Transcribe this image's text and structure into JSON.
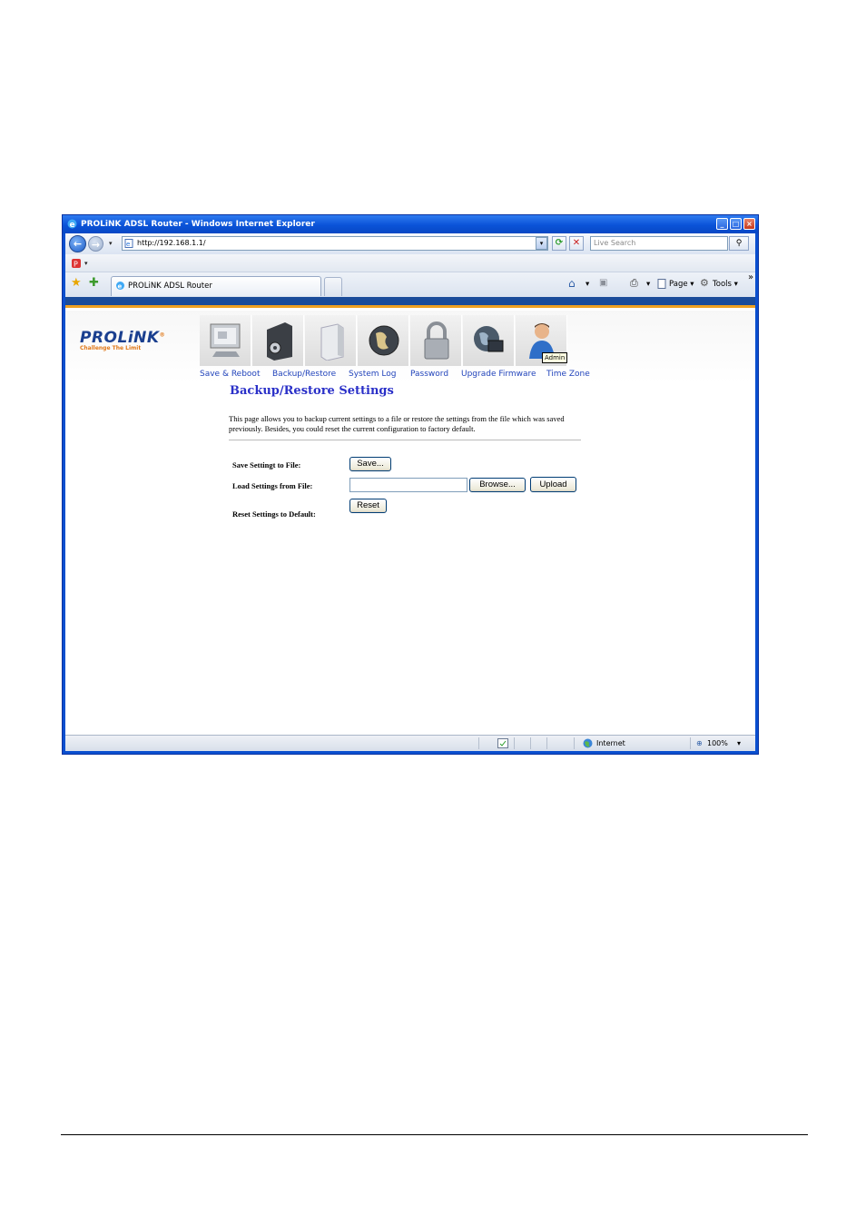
{
  "window": {
    "title": "PROLiNK ADSL Router - Windows Internet Explorer",
    "minimize": "_",
    "maximize": "□",
    "close": "×"
  },
  "navbar": {
    "back_icon": "back-arrow-icon",
    "forward_icon": "forward-arrow-icon",
    "back_glyph": "←",
    "forward_glyph": "→",
    "address": "http://192.168.1.1/",
    "refresh_glyph": "⟳",
    "stop_glyph": "✕",
    "search_placeholder": "Live Search",
    "search_glyph": "⚲",
    "caret": "▾"
  },
  "tab": {
    "title": "PROLiNK ADSL Router"
  },
  "command_bar": {
    "page_label": "Page",
    "tools_label": "Tools",
    "more": "»",
    "favorites_glyph": "★",
    "add_fav_glyph": "✚",
    "home_glyph": "⌂",
    "feeds_glyph": "▣",
    "print_glyph": "⎙",
    "tools_glyph": "⚙"
  },
  "router": {
    "brand": "PROLiNK",
    "brand_mark": "®",
    "tagline": "Challenge The Limit",
    "nav": [
      {
        "label": "Save & Reboot"
      },
      {
        "label": "Backup/Restore"
      },
      {
        "label": "System Log"
      },
      {
        "label": "Password"
      },
      {
        "label": "Upgrade Firmware"
      },
      {
        "label": "Time Zone"
      }
    ],
    "tooltip": "Admin"
  },
  "main": {
    "title": "Backup/Restore Settings",
    "description": "This page allows you to backup current settings to a file or restore the settings from the file which was saved previously. Besides, you could reset the current configuration to factory default.",
    "save_label": "Save Settingt to File:",
    "save_button": "Save...",
    "load_label": "Load Settings from File:",
    "browse_button": "Browse...",
    "upload_button": "Upload",
    "reset_label": "Reset Settings to Default:",
    "reset_button": "Reset"
  },
  "statusbar": {
    "zone": "Internet",
    "zoom": "100%",
    "zoom_glyph": "⊕",
    "caret": "▾"
  },
  "colors": {
    "title_blue": "#2a30c8",
    "nav_link": "#2244bb",
    "brand_blue": "#1a3f8f",
    "accent_orange": "#f0a020"
  }
}
